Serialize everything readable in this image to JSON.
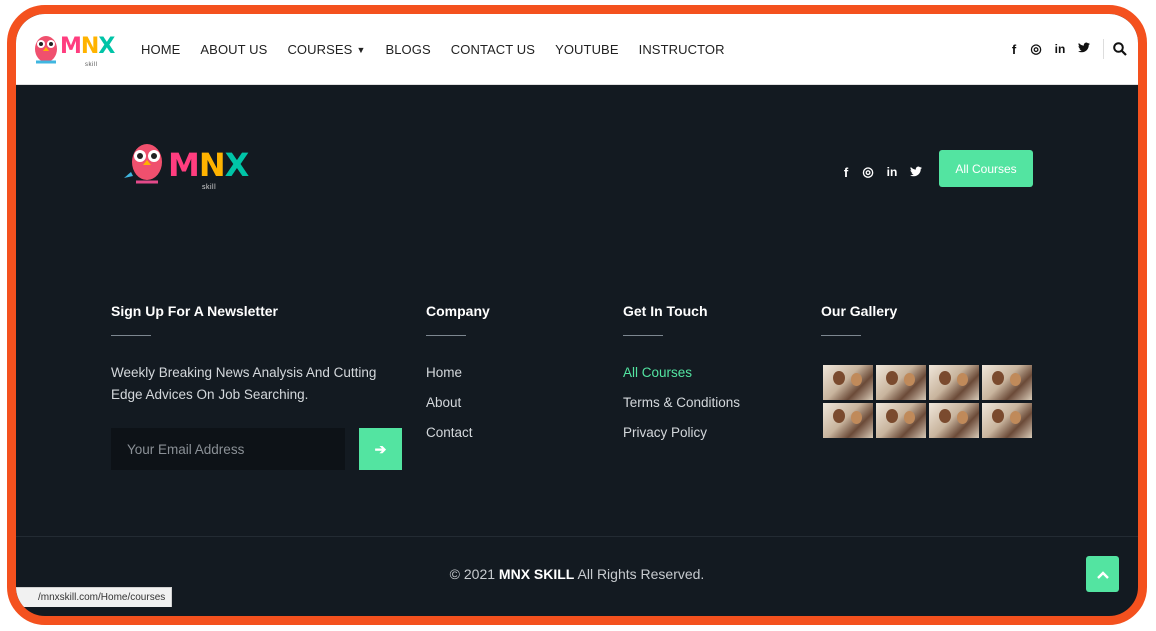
{
  "brand": {
    "logo_word_m": "M",
    "logo_word_n": "N",
    "logo_word_x": "X",
    "logo_sub": "skill"
  },
  "nav": {
    "items": [
      {
        "label": "HOME"
      },
      {
        "label": "ABOUT US"
      },
      {
        "label": "COURSES"
      },
      {
        "label": "BLOGS"
      },
      {
        "label": "CONTACT US"
      },
      {
        "label": "YOUTUBE"
      },
      {
        "label": "INSTRUCTOR"
      }
    ]
  },
  "social": {
    "facebook": "f",
    "instagram": "◎",
    "linkedin": "in",
    "twitter": "🐦"
  },
  "cta": {
    "label": "All Courses"
  },
  "newsletter": {
    "title": "Sign Up For A Newsletter",
    "description": "Weekly Breaking News Analysis And Cutting Edge Advices On Job Searching.",
    "email_placeholder": "Your Email Address",
    "submit_icon": "➔"
  },
  "company": {
    "title": "Company",
    "links": [
      "Home",
      "About",
      "Contact"
    ]
  },
  "get_in_touch": {
    "title": "Get In Touch",
    "links": [
      "All Courses",
      "Terms & Conditions",
      "Privacy Policy"
    ]
  },
  "gallery": {
    "title": "Our Gallery",
    "count": 8
  },
  "footer": {
    "copyright_prefix": "© 2021 ",
    "copyright_brand": "MNX SKILL",
    "copyright_suffix": " All Rights Reserved.",
    "back_to_top_icon": "^"
  },
  "status_bar": {
    "url": "/mnxskill.com/Home/courses"
  },
  "colors": {
    "accent": "#53e4a1",
    "frame": "#f4511e",
    "footer_bg": "#131a21"
  }
}
